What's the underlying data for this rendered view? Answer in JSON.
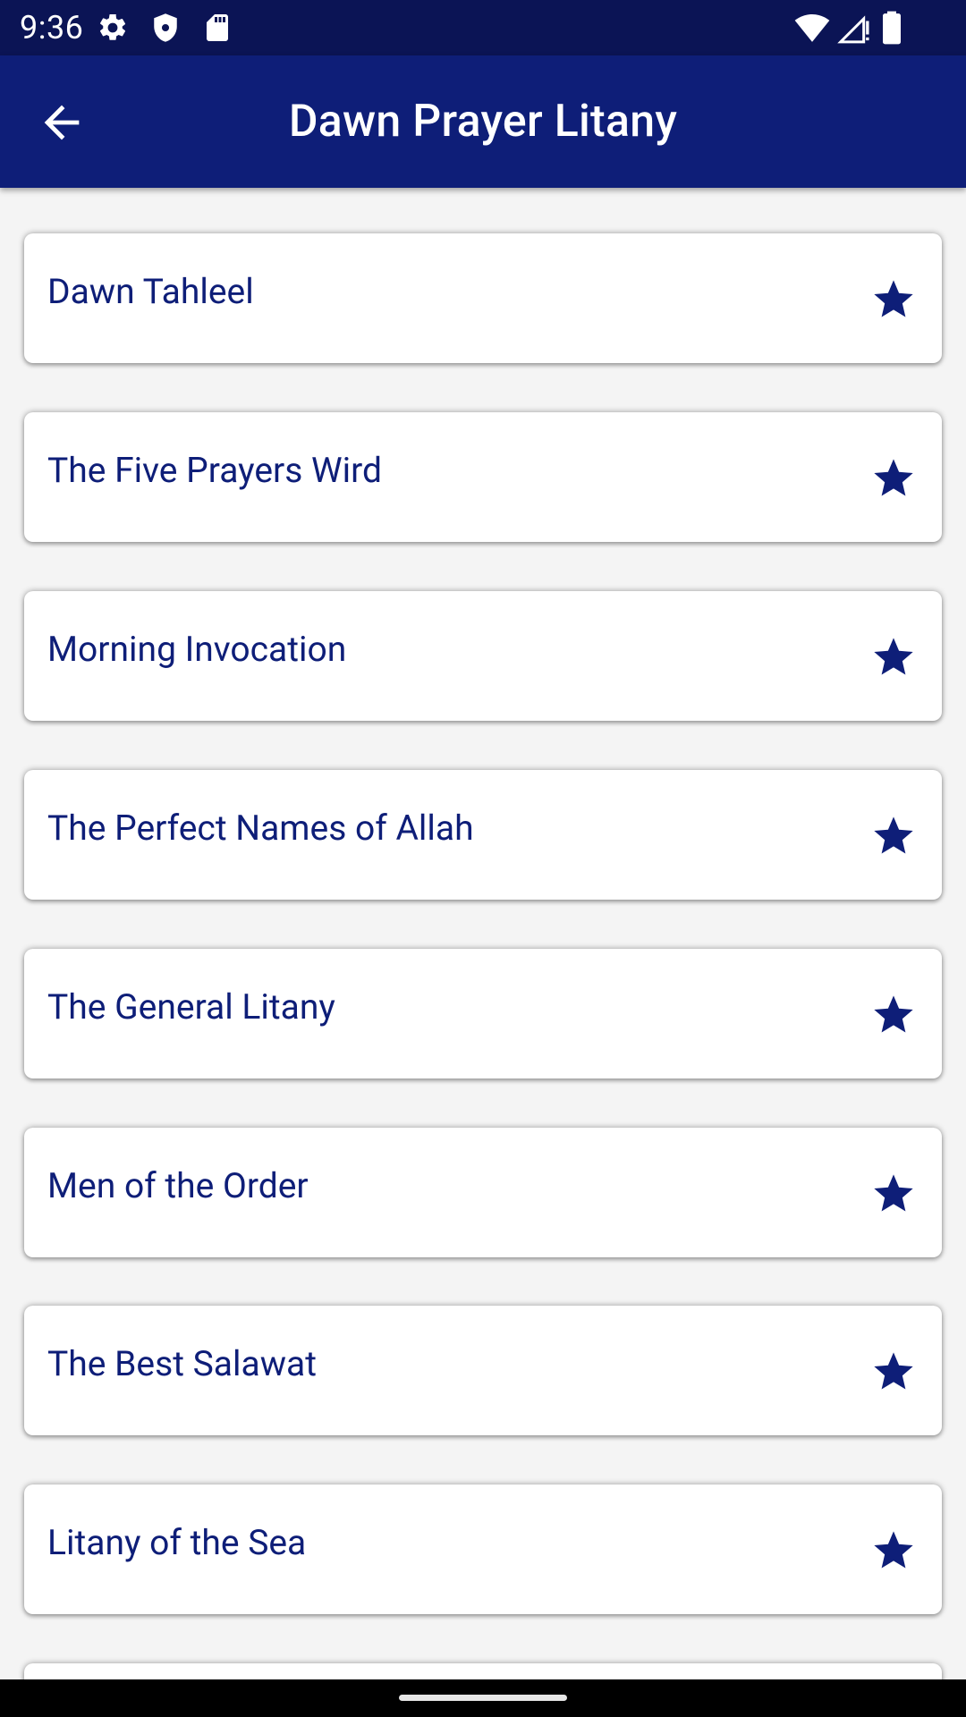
{
  "status_bar": {
    "time": "9:36",
    "icons_left": [
      "settings-icon",
      "shield-icon",
      "sd-card-icon"
    ],
    "icons_right": [
      "wifi-icon",
      "cell-signal-icon",
      "battery-icon"
    ]
  },
  "app_bar": {
    "title": "Dawn Prayer Litany",
    "back_icon": "arrow-back-icon"
  },
  "list": {
    "items": [
      {
        "label": "Dawn Tahleel"
      },
      {
        "label": "The Five Prayers Wird"
      },
      {
        "label": "Morning Invocation"
      },
      {
        "label": "The Perfect Names of Allah"
      },
      {
        "label": "The General Litany"
      },
      {
        "label": "Men of the Order"
      },
      {
        "label": "The Best Salawat"
      },
      {
        "label": "Litany of the Sea"
      },
      {
        "label": ""
      }
    ],
    "item_icon": "star-icon"
  },
  "colors": {
    "status_bar": "#0b1455",
    "app_bar": "#0e1e78",
    "accent": "#0e1e78",
    "background": "#f4f4f4",
    "card": "#ffffff"
  }
}
